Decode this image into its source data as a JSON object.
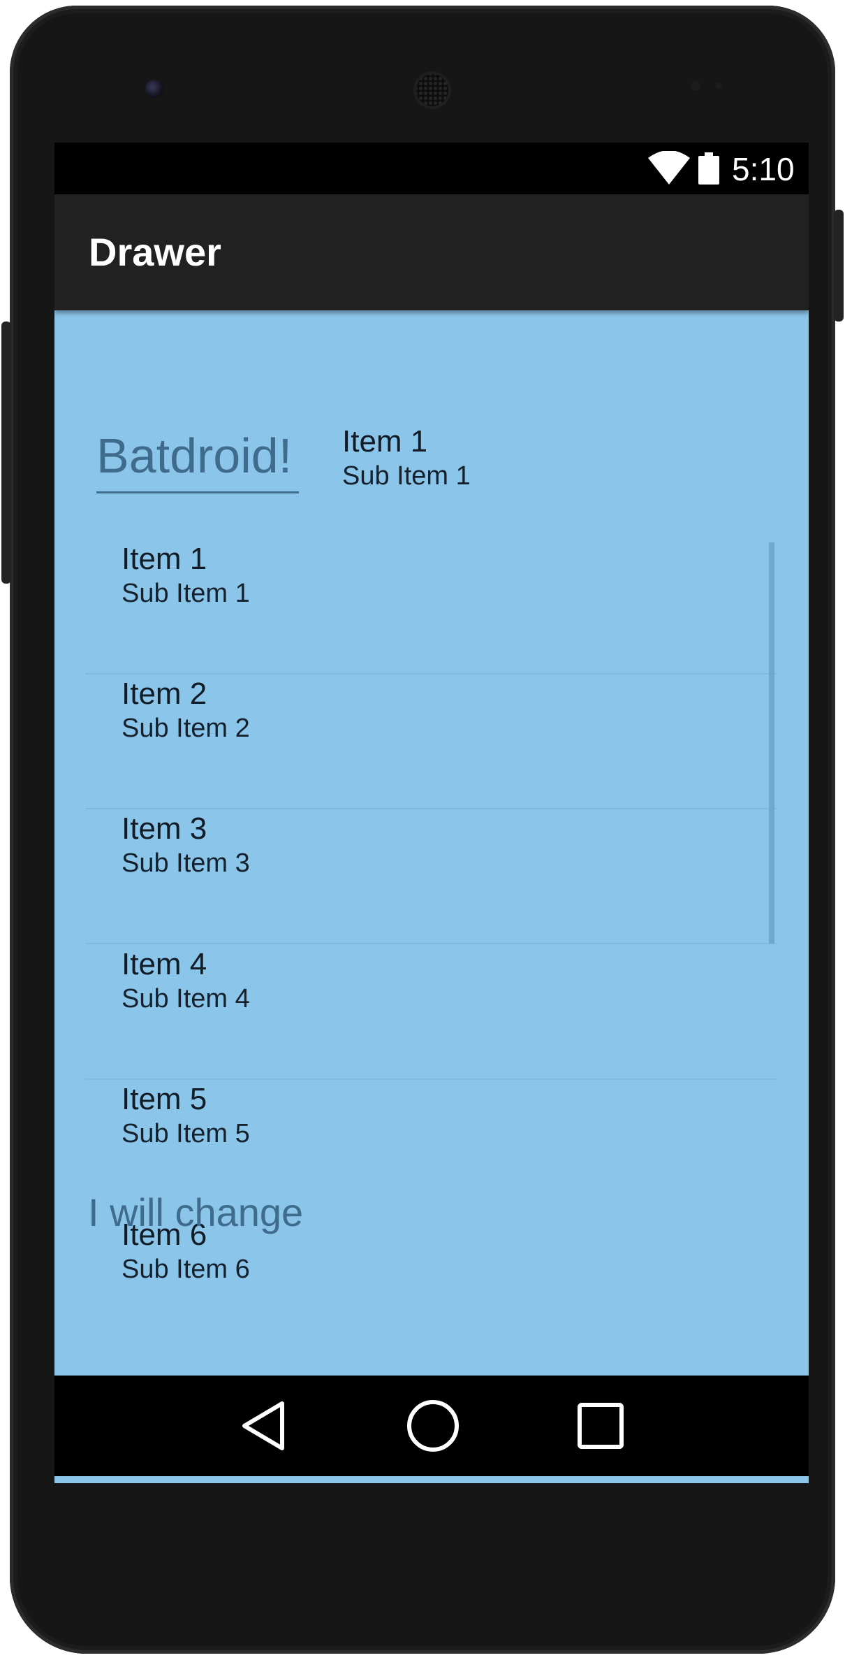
{
  "status_bar": {
    "time": "5:10",
    "icons": [
      "wifi-icon",
      "battery-icon"
    ]
  },
  "app_bar": {
    "title": "Drawer"
  },
  "header": {
    "logo_text": "Batdroid!",
    "item": {
      "title": "Item 1",
      "subtitle": "Sub Item 1"
    }
  },
  "list": {
    "items": [
      {
        "title": "Item 1",
        "subtitle": "Sub Item 1"
      },
      {
        "title": "Item 2",
        "subtitle": "Sub Item 2"
      },
      {
        "title": "Item 3",
        "subtitle": "Sub Item 3"
      },
      {
        "title": "Item 4",
        "subtitle": "Sub Item 4"
      },
      {
        "title": "Item 5",
        "subtitle": "Sub Item 5"
      },
      {
        "title": "Item 6",
        "subtitle": "Sub Item 6"
      }
    ]
  },
  "overlay_text": "I will change",
  "nav_bar": {
    "buttons": [
      "back-icon",
      "home-icon",
      "recents-icon"
    ]
  },
  "colors": {
    "background": "#8bc5ea",
    "app_bar": "#212121",
    "accent_text": "#3f6b8c"
  }
}
